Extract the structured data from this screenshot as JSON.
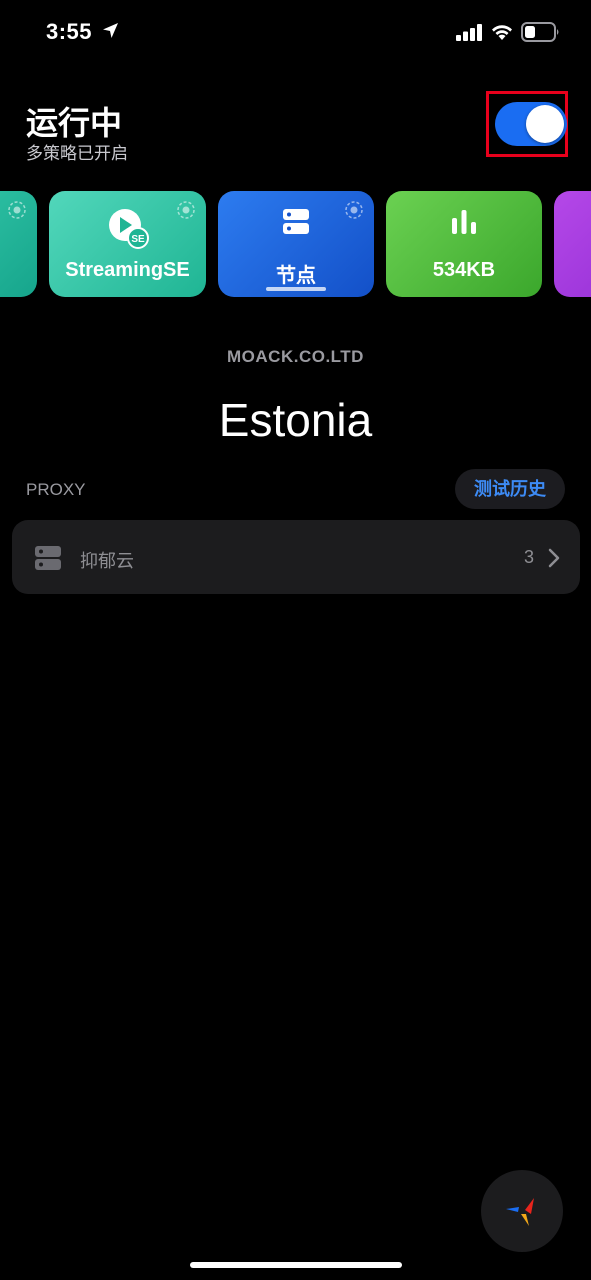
{
  "status_bar": {
    "time": "3:55",
    "icons": [
      "location-arrow-icon",
      "cellular-signal-icon",
      "wifi-icon",
      "battery-icon"
    ]
  },
  "header": {
    "title": "运行中",
    "subtitle": "多策略已开启",
    "toggle": {
      "state": "on",
      "color": "#1a6df2"
    }
  },
  "cards": [
    {
      "label": "",
      "icon": "partial-card",
      "color": "#16a58c"
    },
    {
      "label": "StreamingSE",
      "icon": "play-se-icon",
      "color": "#1fb594"
    },
    {
      "label": "节点",
      "icon": "server-icon",
      "color": "#1350c8",
      "selected": true
    },
    {
      "label": "534KB",
      "icon": "bar-chart-icon",
      "color": "#3ba72c"
    },
    {
      "label": "",
      "icon": "partial-card",
      "color": "#8b28d0"
    }
  ],
  "main": {
    "provider": "MOACK.CO.LTD",
    "location": "Estonia",
    "section_label": "PROXY",
    "history_button": "测试历史",
    "group": {
      "name": "抑郁云",
      "count": "3",
      "icon": "server-icon"
    }
  },
  "colors": {
    "accent": "#3d8bf5",
    "highlight": "#e8001c"
  }
}
